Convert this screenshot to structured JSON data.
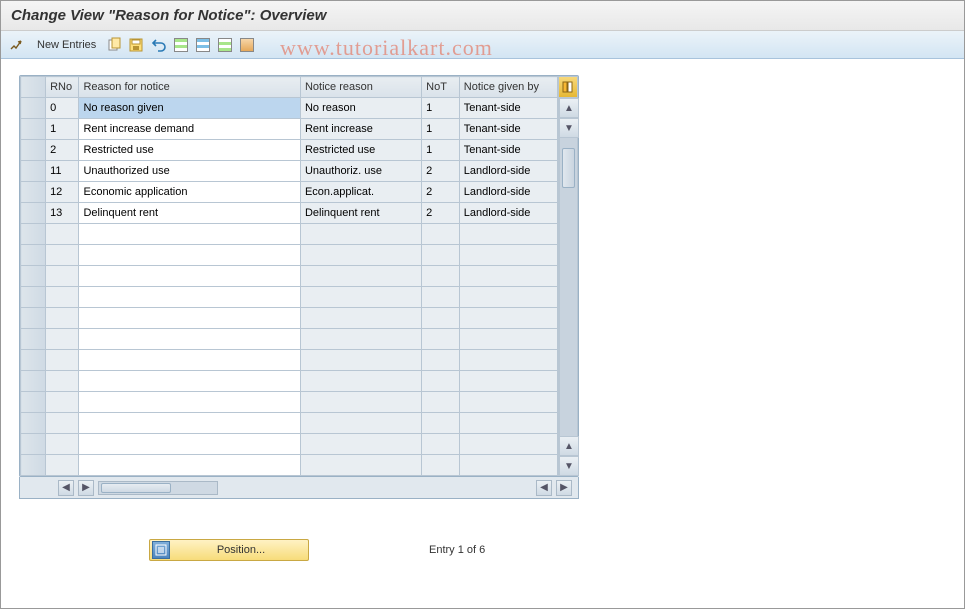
{
  "title": "Change View \"Reason for Notice\": Overview",
  "watermark": "www.tutorialkart.com",
  "toolbar": {
    "new_entries": "New Entries"
  },
  "columns": {
    "rno": "RNo",
    "reason": "Reason for notice",
    "nreason": "Notice reason",
    "not": "NoT",
    "given": "Notice given by"
  },
  "rows": [
    {
      "rno": "0",
      "reason": "No reason given",
      "nreason": "No reason",
      "not": "1",
      "given": "Tenant-side",
      "selected": true
    },
    {
      "rno": "1",
      "reason": "Rent increase demand",
      "nreason": "Rent increase",
      "not": "1",
      "given": "Tenant-side"
    },
    {
      "rno": "2",
      "reason": "Restricted use",
      "nreason": "Restricted use",
      "not": "1",
      "given": "Tenant-side"
    },
    {
      "rno": "11",
      "reason": "Unauthorized use",
      "nreason": "Unauthoriz. use",
      "not": "2",
      "given": "Landlord-side"
    },
    {
      "rno": "12",
      "reason": "Economic application",
      "nreason": "Econ.applicat.",
      "not": "2",
      "given": "Landlord-side"
    },
    {
      "rno": "13",
      "reason": "Delinquent rent",
      "nreason": "Delinquent rent",
      "not": "2",
      "given": "Landlord-side"
    }
  ],
  "empty_rows": 12,
  "footer": {
    "position_label": "Position...",
    "entry_status": "Entry 1 of 6"
  }
}
